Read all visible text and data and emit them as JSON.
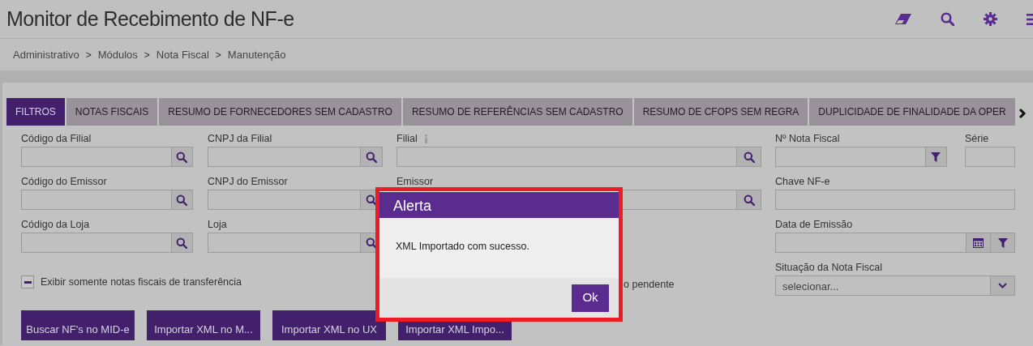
{
  "header": {
    "title": "Monitor de Recebimento de NF-e"
  },
  "breadcrumb": [
    {
      "kind": "link",
      "text": "Administrativo"
    },
    {
      "kind": "separator",
      "text": ">"
    },
    {
      "kind": "link",
      "text": "Módulos"
    },
    {
      "kind": "separator",
      "text": ">"
    },
    {
      "kind": "link",
      "text": "Nota Fiscal"
    },
    {
      "kind": "separator",
      "text": ">"
    },
    {
      "kind": "link",
      "text": "Manutenção"
    }
  ],
  "tabs": [
    {
      "label": "FILTROS",
      "selected": true
    },
    {
      "label": "NOTAS FISCAIS",
      "selected": false
    },
    {
      "label": "RESUMO DE FORNECEDORES SEM CADASTRO",
      "selected": false
    },
    {
      "label": "RESUMO DE REFERÊNCIAS SEM CADASTRO",
      "selected": false
    },
    {
      "label": "RESUMO DE CFOPS SEM REGRA",
      "selected": false
    },
    {
      "label": "DUPLICIDADE DE FINALIDADE DA OPER",
      "selected": false
    }
  ],
  "filters": {
    "left": {
      "fields": [
        {
          "label": "Código da Filial",
          "kind": "lookup"
        },
        {
          "label": "CNPJ da Filial",
          "kind": "lookup"
        },
        {
          "label": "Código do Emissor",
          "kind": "lookup"
        },
        {
          "label": "CNPJ do Emissor",
          "kind": "lookup"
        },
        {
          "label": "Código da Loja",
          "kind": "lookup"
        },
        {
          "label": "Loja",
          "kind": "lookup"
        }
      ],
      "checkbox": {
        "label": "Exibir somente notas fiscais de transferência",
        "checked": true
      }
    },
    "middle": {
      "fields": [
        {
          "label": "Filial",
          "kind": "lookup",
          "info": true
        },
        {
          "label": "Emissor",
          "kind": "lookup"
        }
      ],
      "checkbox_text": "o pendente"
    },
    "right": {
      "fields": [
        {
          "label": "Nº Nota Fiscal",
          "kind": "filter"
        },
        {
          "label": "Série",
          "kind": "text"
        },
        {
          "label": "Chave NF-e",
          "kind": "text"
        },
        {
          "label": "Data de Emissão",
          "kind": "date"
        },
        {
          "label": "Situação da Nota Fiscal",
          "kind": "select",
          "placeholder": "selecionar..."
        }
      ]
    }
  },
  "buttons": [
    "Buscar NF's no MID-e",
    "Importar XML no M...",
    "Importar XML no UX",
    "Importar XML Impo..."
  ],
  "dialog": {
    "title": "Alerta",
    "message": "XML Importado com sucesso.",
    "buttons": [
      "Ok"
    ]
  }
}
